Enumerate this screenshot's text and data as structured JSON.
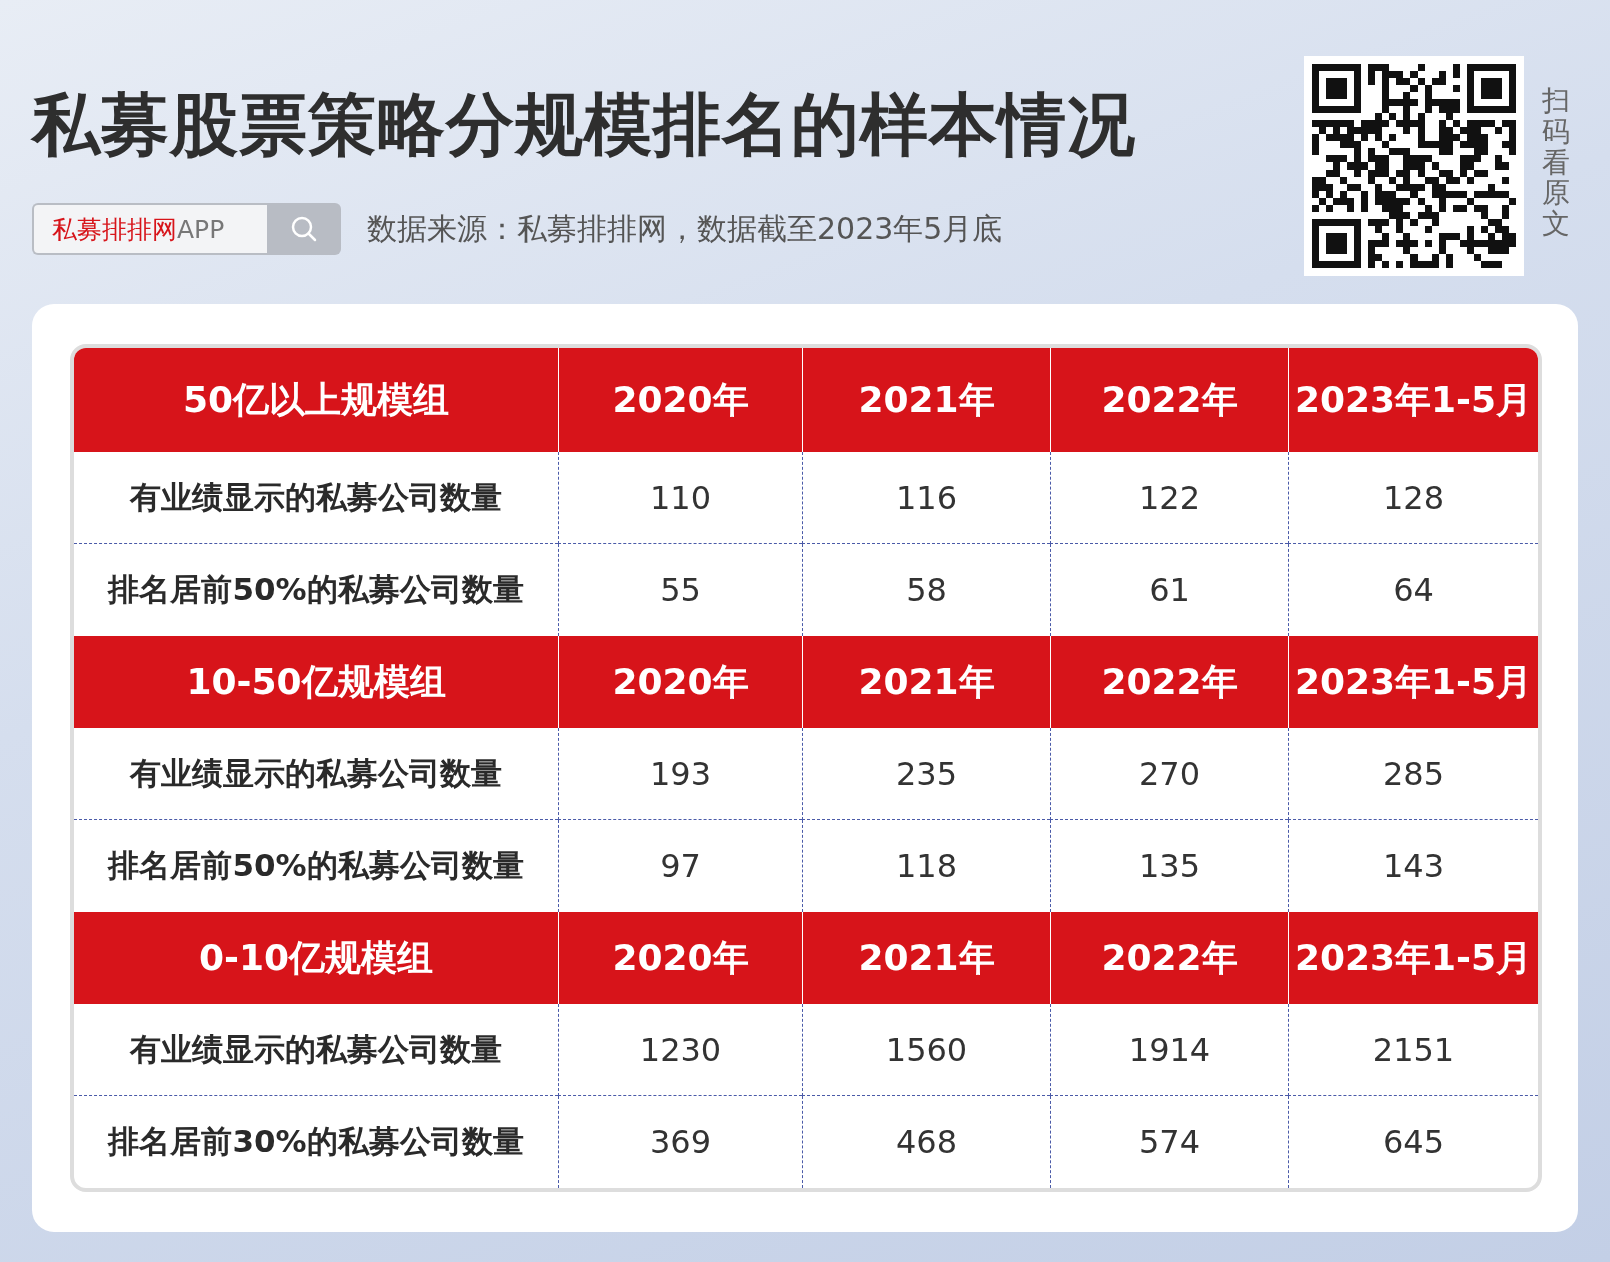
{
  "title": "私募股票策略分规模排名的样本情况",
  "search": {
    "brand": "私募排排网",
    "suffix": "APP"
  },
  "source": "数据来源：私募排排网，数据截至2023年5月底",
  "qr_caption": "扫码看原文",
  "groups": [
    {
      "header": [
        "50亿以上规模组",
        "2020年",
        "2021年",
        "2022年",
        "2023年1-5月"
      ],
      "rows": [
        {
          "label": "有业绩显示的私募公司数量",
          "values": [
            "110",
            "116",
            "122",
            "128"
          ]
        },
        {
          "label": "排名居前50%的私募公司数量",
          "values": [
            "55",
            "58",
            "61",
            "64"
          ]
        }
      ]
    },
    {
      "header": [
        "10-50亿规模组",
        "2020年",
        "2021年",
        "2022年",
        "2023年1-5月"
      ],
      "rows": [
        {
          "label": "有业绩显示的私募公司数量",
          "values": [
            "193",
            "235",
            "270",
            "285"
          ]
        },
        {
          "label": "排名居前50%的私募公司数量",
          "values": [
            "97",
            "118",
            "135",
            "143"
          ]
        }
      ]
    },
    {
      "header": [
        "0-10亿规模组",
        "2020年",
        "2021年",
        "2022年",
        "2023年1-5月"
      ],
      "rows": [
        {
          "label": "有业绩显示的私募公司数量",
          "values": [
            "1230",
            "1560",
            "1914",
            "2151"
          ]
        },
        {
          "label": "排名居前30%的私募公司数量",
          "values": [
            "369",
            "468",
            "574",
            "645"
          ]
        }
      ]
    }
  ]
}
